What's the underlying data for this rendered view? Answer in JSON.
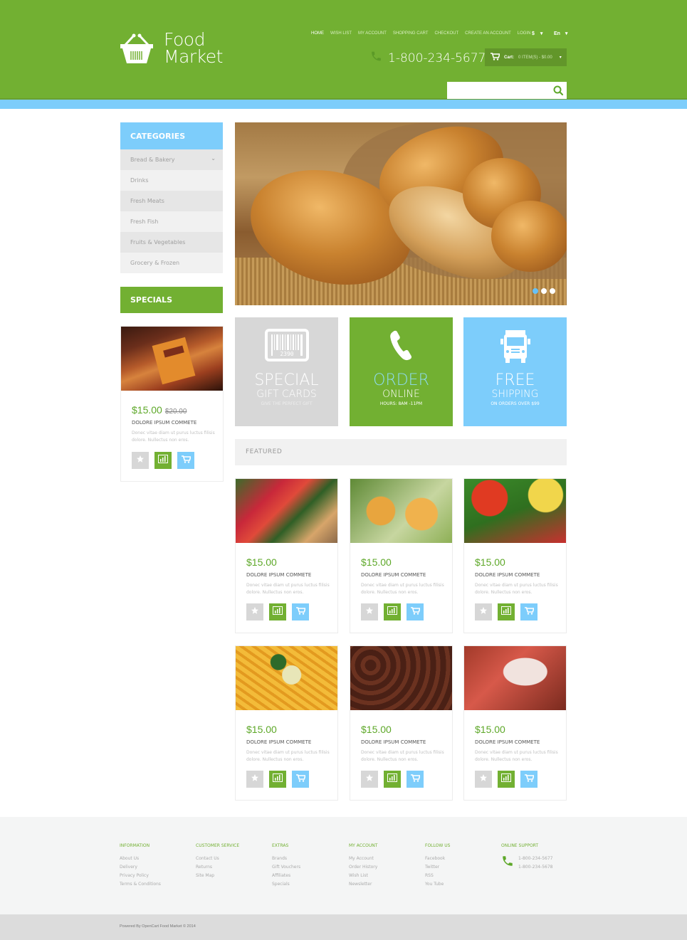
{
  "header": {
    "logo_line1": "Food",
    "logo_line2": "Market",
    "nav": [
      "Home",
      "Wish List",
      "My Account",
      "Shopping Cart",
      "Checkout",
      "Create an Account",
      "Login"
    ],
    "currency": "$",
    "language": "En",
    "phone": "1-800-234-5677",
    "cart_label": "Cart:",
    "cart_value": "0 ITEM(S) - $0.00",
    "search_placeholder": ""
  },
  "colors": {
    "brand_green": "#72b032",
    "accent_blue": "#7dcdfb",
    "light_gray": "#d7d7d7"
  },
  "sidebar": {
    "categories_title": "CATEGORIES",
    "categories": [
      "Bread & Bakery",
      "Drinks",
      "Fresh Meats",
      "Fresh Fish",
      "Fruits & Vegetables",
      "Grocery & Frozen"
    ],
    "specials_title": "SPECIALS",
    "special_product": {
      "price": "$15.00",
      "old_price": "$20.00",
      "name": "DOLORE IPSUM COMMETE",
      "desc": "Donec vitae diam ut purus luctus filisis dolore. Nullectus non eros."
    }
  },
  "slider": {
    "slides": 3,
    "active_slide": 1
  },
  "banners": [
    {
      "line1": "SPECIAL",
      "line2": "GIFT CARDS",
      "line3": "GIVE THE PERFECT GIFT",
      "icon": "barcode-icon",
      "barcode_digits": "2390"
    },
    {
      "line1": "ORDER",
      "line2": "ONLINE",
      "line3": "HOURS: 8AM -11PM",
      "icon": "phone-icon"
    },
    {
      "line1": "FREE",
      "line2": "SHIPPING",
      "line3": "ON ORDERS OVER $99",
      "icon": "truck-icon"
    }
  ],
  "featured": {
    "title": "FEATURED",
    "products": [
      {
        "price": "$15.00",
        "name": "DOLORE IPSUM COMMETE",
        "desc": "Donec vitae diam ut purus luctus filisis dolore. Nullectus non eros."
      },
      {
        "price": "$15.00",
        "name": "DOLORE IPSUM COMMETE",
        "desc": "Donec vitae diam ut purus luctus filisis dolore. Nullectus non eros."
      },
      {
        "price": "$15.00",
        "name": "DOLORE IPSUM COMMETE",
        "desc": "Donec vitae diam ut purus luctus filisis dolore. Nullectus non eros."
      },
      {
        "price": "$15.00",
        "name": "DOLORE IPSUM COMMETE",
        "desc": "Donec vitae diam ut purus luctus filisis dolore. Nullectus non eros."
      },
      {
        "price": "$15.00",
        "name": "DOLORE IPSUM COMMETE",
        "desc": "Donec vitae diam ut purus luctus filisis dolore. Nullectus non eros."
      },
      {
        "price": "$15.00",
        "name": "DOLORE IPSUM COMMETE",
        "desc": "Donec vitae diam ut purus luctus filisis dolore. Nullectus non eros."
      }
    ]
  },
  "footer": {
    "columns": [
      {
        "title": "INFORMATION",
        "links": [
          "About Us",
          "Delivery",
          "Privacy Policy",
          "Terms & Conditions"
        ]
      },
      {
        "title": "CUSTOMER SERVICE",
        "links": [
          "Contact Us",
          "Returns",
          "Site Map"
        ]
      },
      {
        "title": "EXTRAS",
        "links": [
          "Brands",
          "Gift Vouchers",
          "Affiliates",
          "Specials"
        ]
      },
      {
        "title": "MY ACCOUNT",
        "links": [
          "My Account",
          "Order History",
          "Wish List",
          "Newsletter"
        ]
      },
      {
        "title": "FOLLOW US",
        "links": [
          "Facebook",
          "Twitter",
          "RSS",
          "You Tube"
        ]
      }
    ],
    "support_title": "ONLINE SUPPORT",
    "support_phones": [
      "1-800-234-5677",
      "1-800-234-5678"
    ],
    "copyright": "Powered By OpenCart Food Market © 2014"
  }
}
